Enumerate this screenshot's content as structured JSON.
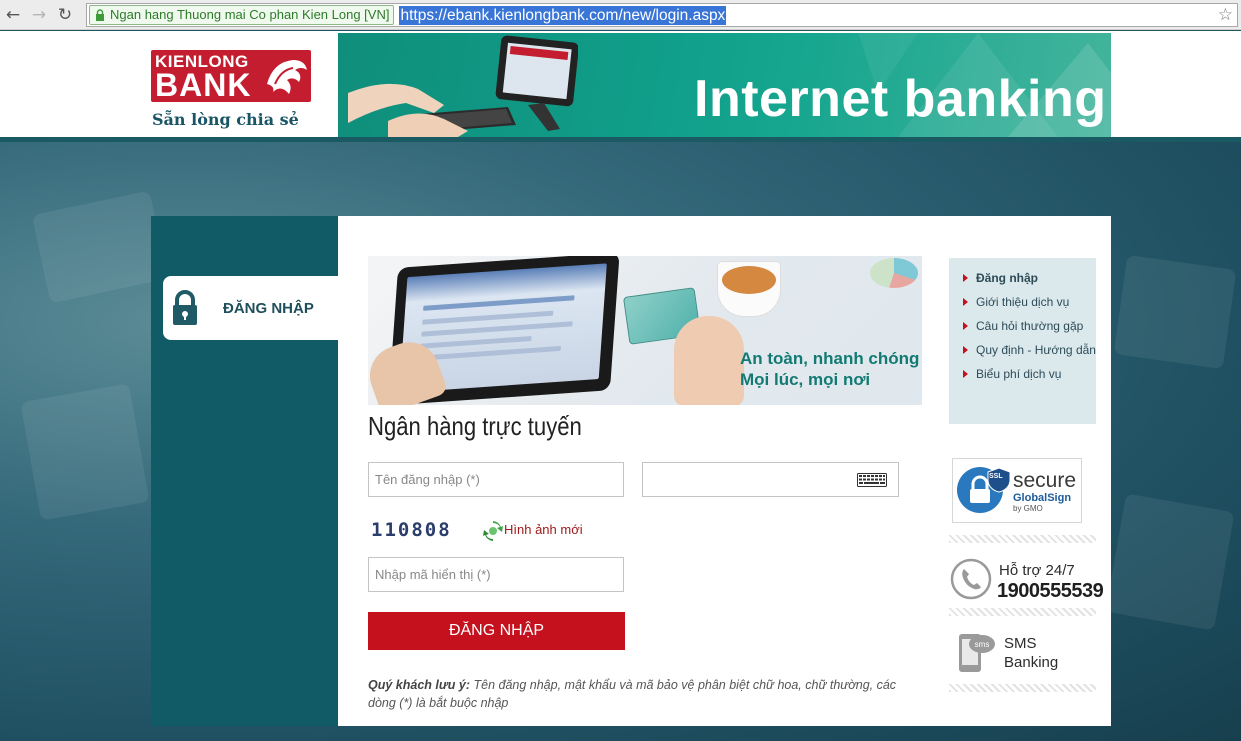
{
  "browser": {
    "back_icon": "back-arrow-icon",
    "forward_icon": "forward-arrow-icon",
    "reload_icon": "reload-icon",
    "ev_label": "Ngan hang Thuong mai Co phan Kien Long [VN]",
    "url": "https://ebank.kienlongbank.com/new/login.aspx",
    "bookmark_icon": "star-icon"
  },
  "header": {
    "logo_line1": "KIENLONG",
    "logo_line2": "BANK",
    "slogan": "Sẵn lòng chia sẻ",
    "banner_title": "Internet banking"
  },
  "tab": {
    "label": "ĐĂNG NHẬP"
  },
  "hero": {
    "line1": "An toàn, nhanh chóng",
    "line2": "Mọi lúc, mọi nơi"
  },
  "form": {
    "title": "Ngân hàng trực tuyến",
    "username_placeholder": "Tên đăng nhập (*)",
    "password_value": "",
    "captcha_code": "110808",
    "refresh_label": "Hình ảnh mới",
    "captcha_placeholder": "Nhập mã hiển thị (*)",
    "submit_label": "ĐĂNG NHẬP",
    "note_label": "Quý khách lưu ý:",
    "note_text": " Tên đăng nhập, mật khẩu và mã bảo vệ phân biệt chữ hoa, chữ thường, các dòng (*) là bắt buộc nhập"
  },
  "sidebar": {
    "items": [
      {
        "label": "Đăng nhập",
        "active": true
      },
      {
        "label": "Giới thiệu dịch vụ"
      },
      {
        "label": "Câu hỏi thường gặp"
      },
      {
        "label": "Quy định - Hướng dẫn"
      },
      {
        "label": "Biểu phí dịch vụ"
      }
    ]
  },
  "ssl": {
    "badge": "SSL",
    "secure": "secure",
    "brand": "GlobalSign",
    "by": "by GMO"
  },
  "support": {
    "label": "Hỗ trợ 24/7",
    "number": "1900555539"
  },
  "sms": {
    "line1": "SMS",
    "line2": "Banking"
  },
  "colors": {
    "brand_red": "#c5101d",
    "brand_teal": "#115b66",
    "banner_green": "#10a08b"
  }
}
